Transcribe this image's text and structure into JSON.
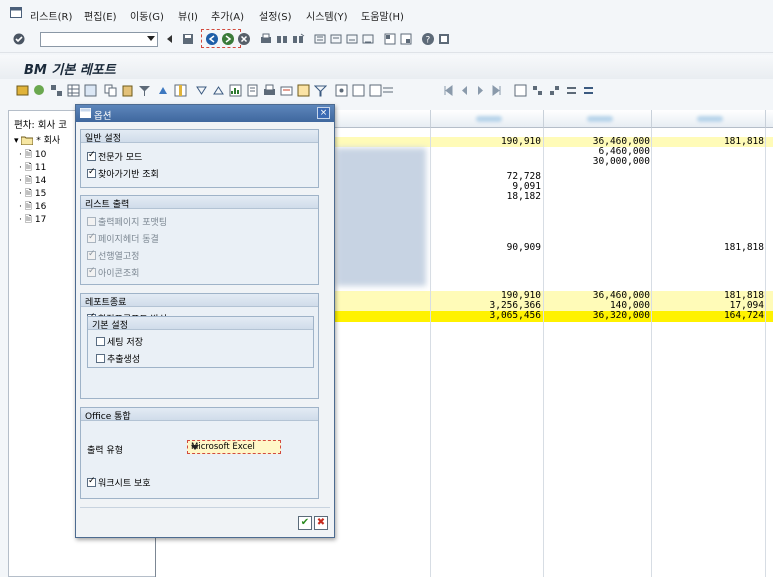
{
  "menubar": {
    "items": [
      "리스트(R)",
      "편집(E)",
      "이동(G)",
      "뷰(I)",
      "추가(A)",
      "설정(S)",
      "시스템(Y)",
      "도움말(H)"
    ]
  },
  "toolbar1": {
    "command_field_value": ""
  },
  "page": {
    "title": "BM 기본 레포트"
  },
  "left_pane": {
    "header": "편차: 회사 코",
    "tree": [
      {
        "label": "* 회사"
      },
      {
        "label": "10"
      },
      {
        "label": "11"
      },
      {
        "label": "14"
      },
      {
        "label": "15"
      },
      {
        "label": "16"
      },
      {
        "label": "17"
      }
    ]
  },
  "grid": {
    "rows": [
      {
        "c1": "190,910",
        "c2": "36,460,000",
        "c3": "181,818"
      },
      {
        "c1": "",
        "c2": "6,460,000",
        "c3": ""
      },
      {
        "c1": "",
        "c2": "30,000,000",
        "c3": ""
      },
      {
        "c1": "72,728",
        "c2": "",
        "c3": ""
      },
      {
        "c1": "9,091",
        "c2": "",
        "c3": ""
      },
      {
        "c1": "18,182",
        "c2": "",
        "c3": ""
      },
      {
        "c1": "90,909",
        "c2": "",
        "c3": "181,818"
      },
      {
        "c1": "190,910",
        "c2": "36,460,000",
        "c3": "181,818"
      },
      {
        "c1": "3,256,366",
        "c2": "140,000",
        "c3": "17,094"
      },
      {
        "c1": "3,065,456",
        "c2": "36,320,000",
        "c3": "164,724"
      }
    ]
  },
  "dialog": {
    "title": "옵션",
    "close_label": "×",
    "groups": {
      "general": {
        "title": "일반 설정",
        "items": [
          {
            "label": "전문가 모드",
            "checked": true,
            "enabled": true
          },
          {
            "label": "찾아가기반 조회",
            "checked": true,
            "enabled": true
          }
        ]
      },
      "list_output": {
        "title": "리스트 출력",
        "items": [
          {
            "label": "출력페이지 포맷팅",
            "checked": false,
            "enabled": false
          },
          {
            "label": "페이지헤더 동결",
            "checked": true,
            "enabled": false
          },
          {
            "label": "선행열고정",
            "checked": true,
            "enabled": false
          },
          {
            "label": "아이콘조회",
            "checked": true,
            "enabled": false
          }
        ]
      },
      "report_end": {
        "title": "레포트종료",
        "items": [
          {
            "label": "확정프롬프트 발신",
            "checked": true,
            "enabled": true
          }
        ],
        "sub_title": "기본 설정",
        "sub_items": [
          {
            "label": "세팅 저장",
            "checked": false,
            "enabled": true
          },
          {
            "label": "추출생성",
            "checked": false,
            "enabled": true
          }
        ]
      },
      "office": {
        "title": "Office 통합",
        "output_type_label": "출력 유형",
        "output_type_value": "Microsoft Excel",
        "protect_label": "워크시트 보호",
        "protect_checked": true
      }
    },
    "ok_label": "✔",
    "cancel_label": "✖"
  }
}
